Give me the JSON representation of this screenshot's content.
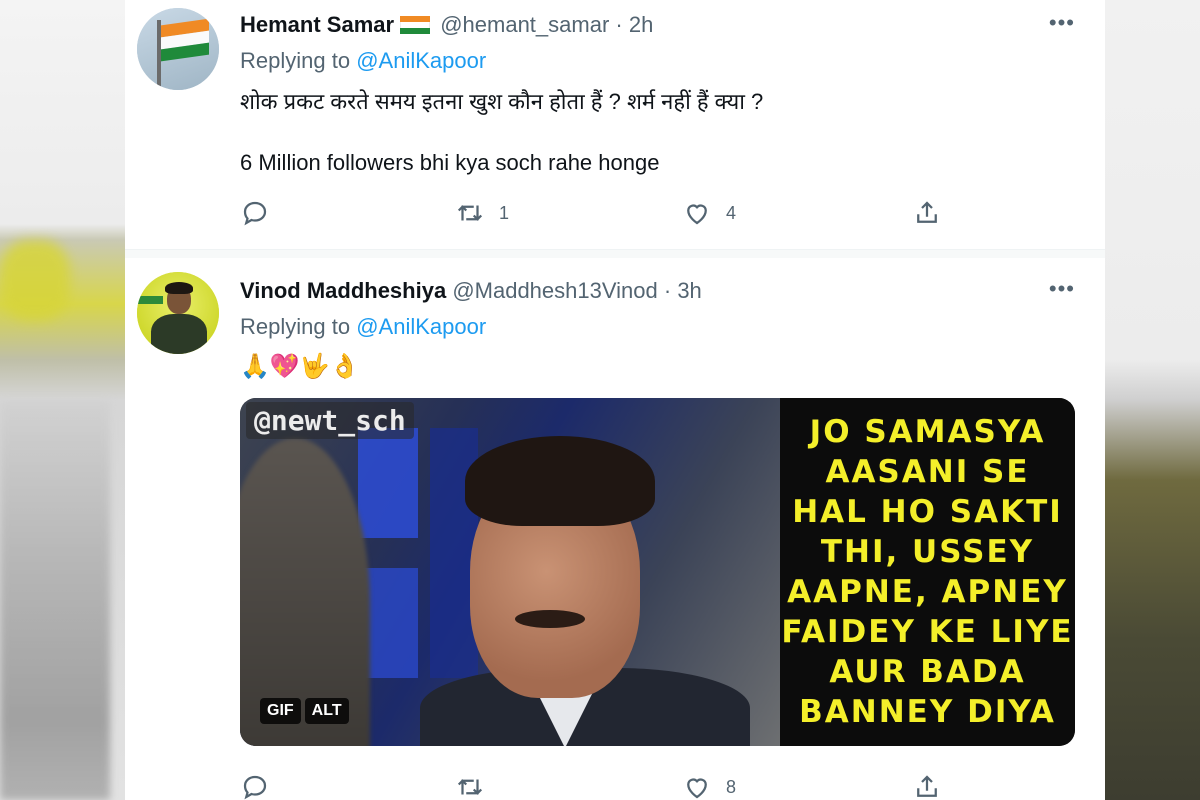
{
  "tweets": [
    {
      "name": "Hemant Samar",
      "handle": "@hemant_samar",
      "separator": "·",
      "time": "2h",
      "replying_prefix": "Replying to",
      "replying_to": "@AnilKapoor",
      "text_line1": "शोक प्रकट करते समय इतना खुश कौन होता हैं ? शर्म नहीं हैं क्या ?",
      "text_line2": "6 Million followers bhi kya soch rahe honge",
      "retweet_count": "1",
      "like_count": "4"
    },
    {
      "name": "Vinod Maddheshiya",
      "handle": "@Maddhesh13Vinod",
      "separator": "·",
      "time": "3h",
      "replying_prefix": "Replying to",
      "replying_to": "@AnilKapoor",
      "emoji_text": "🙏💖🤟👌",
      "like_count": "8",
      "media": {
        "watermark": "@newt_sch",
        "badge_gif": "GIF",
        "badge_alt": "ALT",
        "caption_lines": [
          "JO SAMASYA",
          "AASANI SE",
          "HAL HO SAKTI",
          "THI, USSEY",
          "AAPNE, APNEY",
          "FAIDEY KE LIYE",
          "AUR BADA",
          "BANNEY DIYA"
        ]
      }
    }
  ],
  "icons": {
    "more": "more-dots-icon",
    "reply": "reply-icon",
    "retweet": "retweet-icon",
    "like": "heart-icon",
    "share": "share-icon"
  },
  "colors": {
    "link": "#1d9bf0",
    "secondary_text": "#536471",
    "caption_text": "#f4ef2a"
  }
}
